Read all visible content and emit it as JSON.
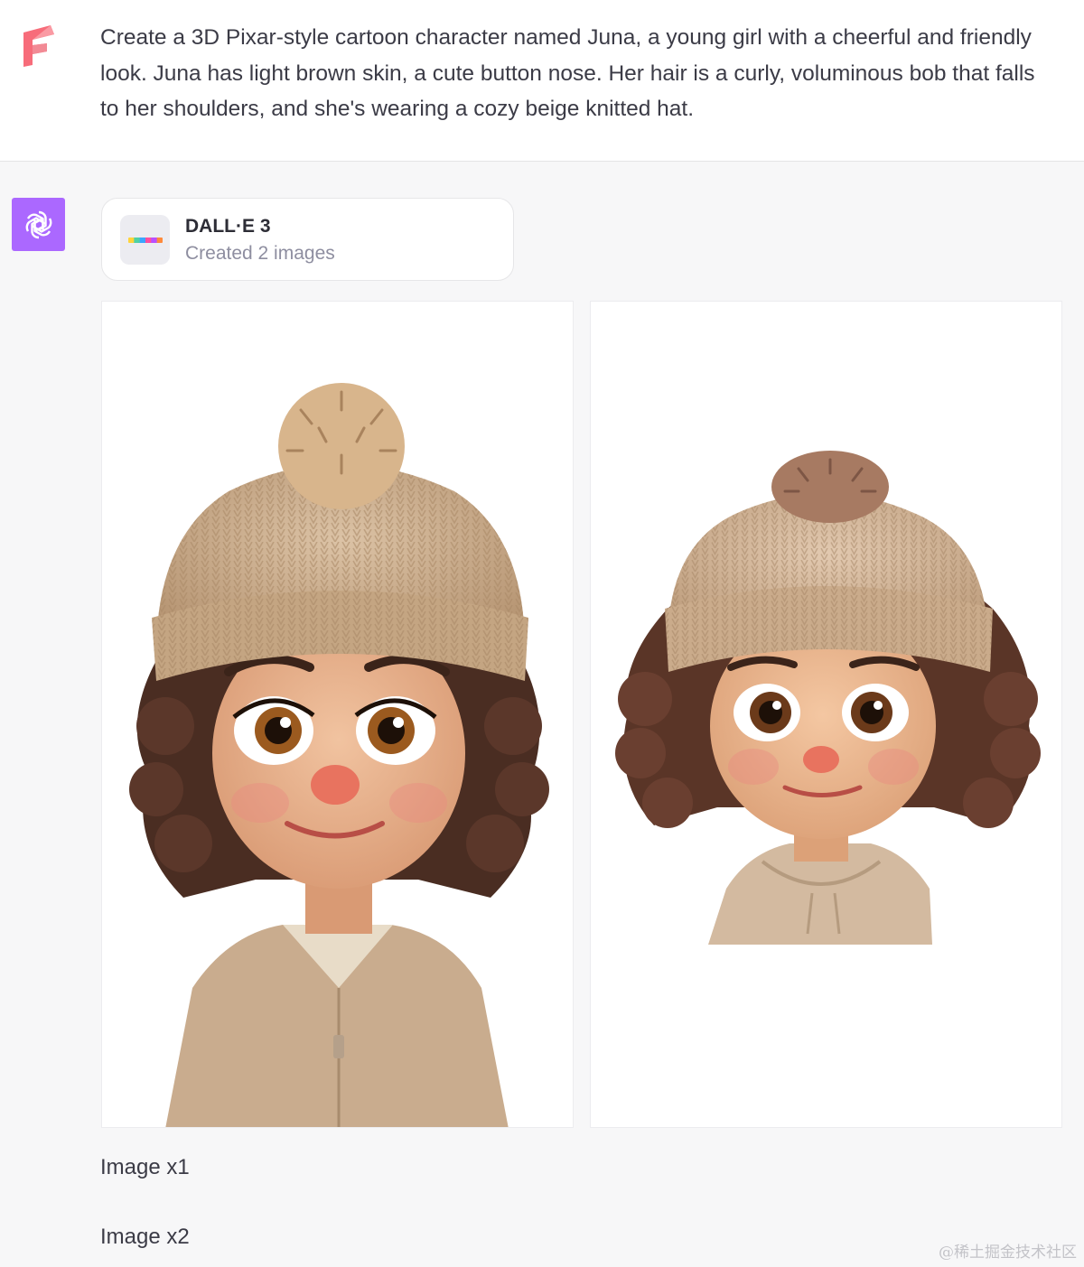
{
  "user_message": {
    "text": "Create a 3D Pixar-style cartoon character named Juna, a young girl with a cheerful and friendly look. Juna has light brown skin, a cute button nose. Her hair is a curly, voluminous bob that falls to her shoulders, and she's wearing a cozy beige knitted hat."
  },
  "assistant": {
    "avatar_icon": "openai-logo-icon",
    "tool": {
      "name": "DALL·E 3",
      "status": "Created 2 images",
      "icon": "dalle-palette-icon",
      "bar_colors": [
        "#ffd43b",
        "#4fd1a5",
        "#3ba5ff",
        "#ff4fa0",
        "#b94fff",
        "#ff8a3b"
      ]
    },
    "images": [
      {
        "label": "Image x1"
      },
      {
        "label": "Image x2"
      }
    ]
  },
  "colors": {
    "user_logo": "#f76c7a",
    "assistant_avatar": "#ab68ff",
    "hat": "#cfb08f",
    "hair": "#4a2d22",
    "skin": "#e7b089",
    "jacket": "#c9ac8e"
  },
  "watermark": "@稀土掘金技术社区"
}
